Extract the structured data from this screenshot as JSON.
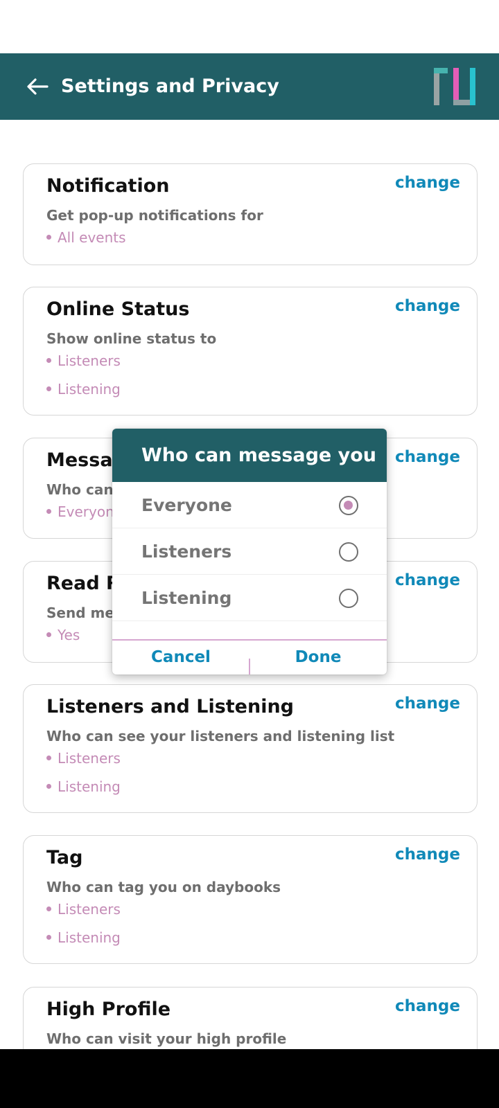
{
  "app_bar": {
    "title": "Settings and Privacy",
    "back_icon": "arrow-left-icon",
    "logo": "app-logo",
    "colors": {
      "background": "#215f66",
      "text": "#ffffff"
    }
  },
  "change_label": "change",
  "cards": [
    {
      "title": "Notification",
      "subtitle": "Get pop-up notifications for",
      "options": [
        "All events"
      ]
    },
    {
      "title": "Online Status",
      "subtitle": "Show online status to",
      "options": [
        "Listeners",
        "Listening"
      ]
    },
    {
      "title": "Messag",
      "subtitle": "Who can s",
      "options": [
        "Everyone"
      ]
    },
    {
      "title": "Read Re",
      "subtitle": "Send mes",
      "options": [
        "Yes"
      ]
    },
    {
      "title": "Listeners and Listening",
      "subtitle": "Who can see your listeners and listening list",
      "options": [
        "Listeners",
        "Listening"
      ]
    },
    {
      "title": "Tag",
      "subtitle": "Who can tag you on daybooks",
      "options": [
        "Listeners",
        "Listening"
      ]
    },
    {
      "title": "High Profile",
      "subtitle": "Who can visit your high profile",
      "options": []
    }
  ],
  "dialog": {
    "title": "Who can message you",
    "options": [
      {
        "label": "Everyone",
        "selected": true
      },
      {
        "label": "Listeners",
        "selected": false
      },
      {
        "label": "Listening",
        "selected": false
      }
    ],
    "cancel_label": "Cancel",
    "done_label": "Done"
  },
  "colors": {
    "accent_link": "#1089b8",
    "option_text": "#c48bb6",
    "radio_selected": "#c48bb6",
    "card_border": "#d6d6d6"
  }
}
